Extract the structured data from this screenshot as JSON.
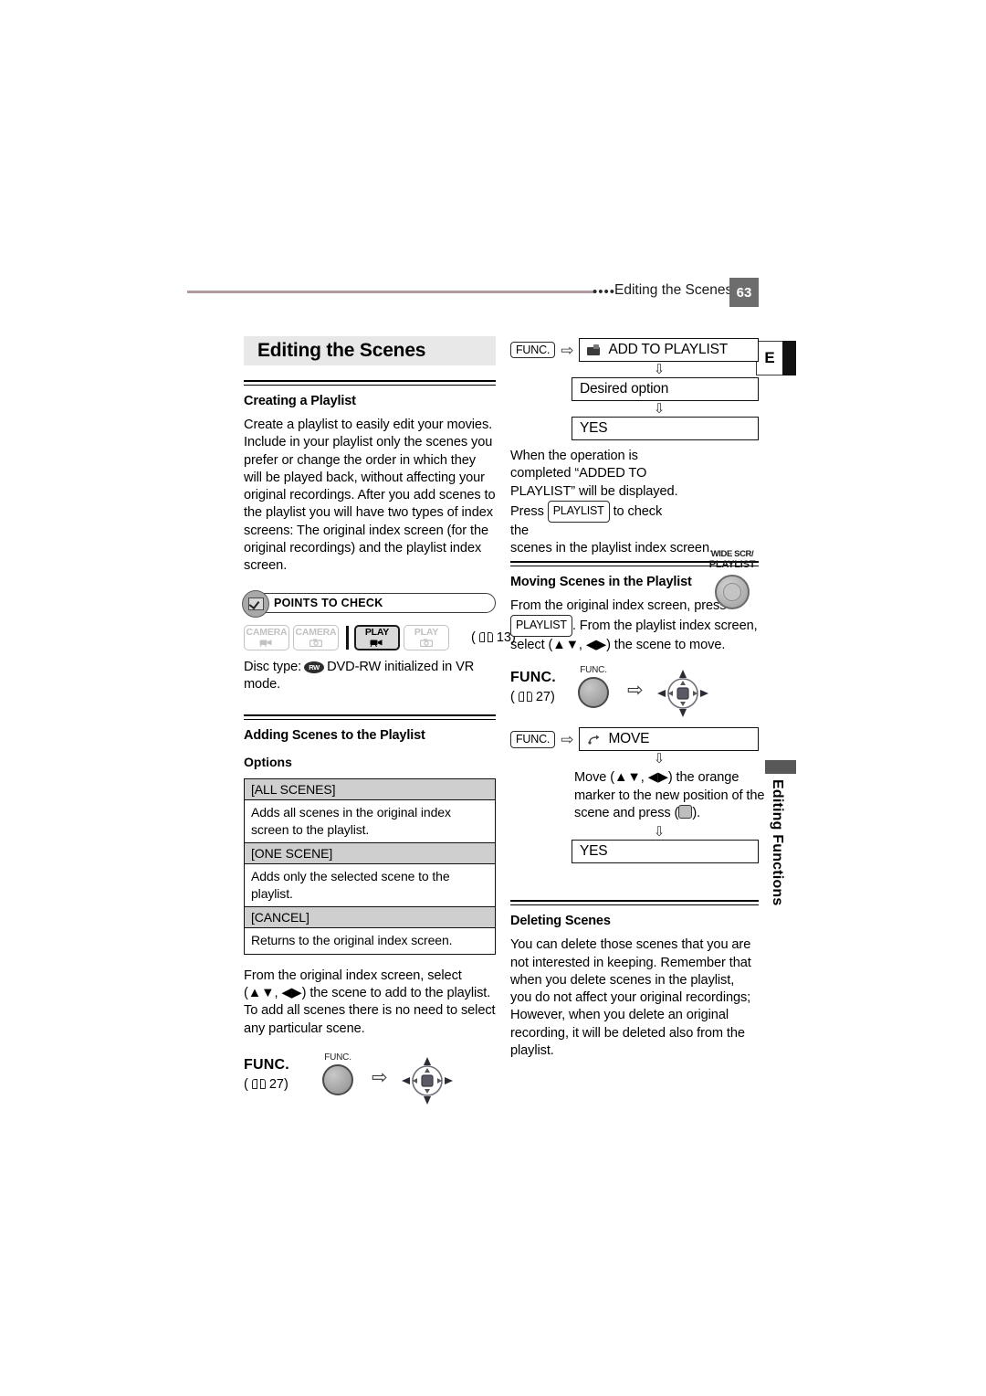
{
  "header": {
    "dots": "••••",
    "title": "Editing the Scenes",
    "page_number": "63",
    "rule_color": "#b09a9d"
  },
  "side_tabs": {
    "letter": "E",
    "vertical_label": "Editing Functions"
  },
  "chapter": {
    "title": "Editing the Scenes"
  },
  "left_column": {
    "creating_playlist": {
      "heading": "Creating a Playlist",
      "body": "Create a playlist to easily edit your movies. Include in your playlist only the scenes you prefer or change the order in which they will be played back, without affecting your original recordings. After you add scenes to the playlist you will have two types of index screens: The original index screen (for the original recordings) and the playlist index screen."
    },
    "points_to_check": {
      "label": "POINTS TO CHECK",
      "badge_icon": "checkbox-check-icon",
      "modes": [
        {
          "name": "CAMERA",
          "glyph": "movie-camera-icon",
          "active": false
        },
        {
          "name": "CAMERA",
          "glyph": "still-camera-icon",
          "active": false
        },
        {
          "name": "PLAY",
          "glyph": "movie-camera-icon",
          "active": true
        },
        {
          "name": "PLAY",
          "glyph": "still-camera-icon",
          "active": false
        }
      ],
      "page_ref": "13",
      "disc_type_prefix": "Disc type:",
      "disc_icon_text": "RW",
      "disc_type_text": "DVD-RW initialized in VR mode."
    },
    "adding_scenes": {
      "heading": "Adding Scenes to the Playlist",
      "options_label": "Options",
      "options": [
        {
          "name": "[ALL SCENES]",
          "description": "Adds all scenes in the original index screen to the playlist."
        },
        {
          "name": "[ONE SCENE]",
          "description": "Adds only the selected scene to the playlist."
        },
        {
          "name": "[CANCEL]",
          "description": "Returns to the original index screen."
        }
      ],
      "instruction": "From the original index screen, select (▲▼, ◀▶) the scene to add to the playlist. To add all scenes there is no need to select any particular scene.",
      "func_block": {
        "label": "FUNC.",
        "page_ref": "27",
        "dial_caption": "FUNC.",
        "arrow": "⇨",
        "joystick_icon": "joystick-icon"
      }
    }
  },
  "right_column": {
    "add_flow": {
      "func_button": "FUNC.",
      "arrow_right": "⇨",
      "arrow_down": "⇩",
      "step1": "ADD TO PLAYLIST",
      "step1_icon": "add-to-playlist-icon",
      "step2": "Desired option",
      "step3": "YES",
      "note_line1": "When the operation is",
      "note_line2": "completed “ADDED TO",
      "note_line3": "PLAYLIST” will be displayed.",
      "note_line4_pre": "Press",
      "note_line4_btn": "PLAYLIST",
      "note_line4_post": "to check the",
      "note_line5": "scenes in the playlist index screen.",
      "widescr_button": {
        "line1": "WIDE SCR/",
        "line2": "PLAYLIST"
      }
    },
    "moving_scenes": {
      "heading": "Moving Scenes in the Playlist",
      "intro_pre": "From the original index screen, press",
      "intro_btn": "PLAYLIST",
      "intro_post": ". From the playlist index screen, select (▲▼, ◀▶) the scene to move.",
      "func_block": {
        "label": "FUNC.",
        "page_ref": "27",
        "dial_caption": "FUNC.",
        "arrow": "⇨",
        "joystick_icon": "joystick-icon"
      },
      "flow": {
        "func_button": "FUNC.",
        "arrow_right": "⇨",
        "arrow_down": "⇩",
        "step1": "MOVE",
        "step1_icon": "move-icon",
        "note": "Move (▲▼, ◀▶) the orange marker to the new position of the scene and press (    ).",
        "note_line1": "Move (▲▼, ◀▶) the orange",
        "note_line2": "marker to the new position of the",
        "note_line3_pre": "scene and press (",
        "note_line3_post": ").",
        "step2": "YES"
      }
    },
    "deleting_scenes": {
      "heading": "Deleting Scenes",
      "body": "You can delete those scenes that you are not interested in keeping. Remember that when you delete scenes in the playlist, you do not affect your original recordings; However, when you delete an original recording, it will be deleted also from the playlist."
    }
  }
}
